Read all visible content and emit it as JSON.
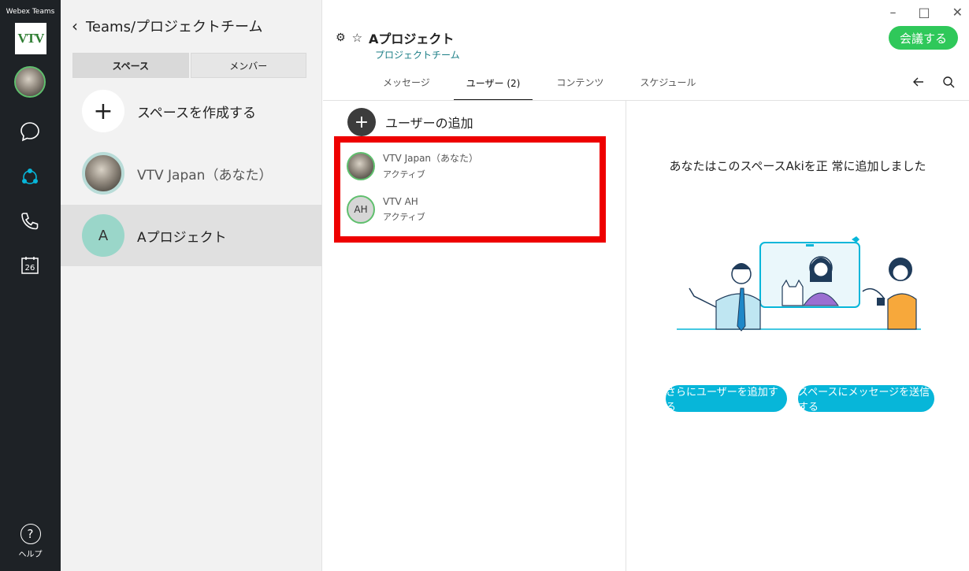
{
  "rail": {
    "app_title": "Webex Teams",
    "logo_text": "VTV",
    "calendar_day": "26",
    "help_label": "ヘルプ"
  },
  "spaces_pane": {
    "header_title": "Teams/プロジェクトチーム",
    "segments": {
      "spaces": "スペース",
      "members": "メンバー"
    },
    "create_space_label": "スペースを作成する",
    "items": [
      {
        "label": "VTV Japan（あなた）"
      },
      {
        "label": "Aプロジェクト",
        "avatar_letter": "A"
      }
    ]
  },
  "main": {
    "space_title": "Aプロジェクト",
    "space_subtitle": "プロジェクトチーム",
    "meet_button": "会議する",
    "tabs": [
      {
        "label": "メッセージ"
      },
      {
        "label": "ユーザー (2)"
      },
      {
        "label": "コンテンツ"
      },
      {
        "label": "スケジュール"
      }
    ],
    "add_user_label": "ユーザーの追加",
    "users": [
      {
        "name": "VTV Japan（あなた）",
        "status": "アクティブ"
      },
      {
        "name": "VTV AH",
        "status": "アクティブ",
        "initials": "AH"
      }
    ],
    "added_message": "あなたはこのスペースAkiを正 常に追加しました",
    "buttons": {
      "add_more_users": "さらにユーザーを追加する",
      "send_message": "スペースにメッセージを送信する"
    }
  },
  "colors": {
    "rail_bg": "#1e2226",
    "accent_green": "#2fc85a",
    "accent_cyan": "#07b6d9",
    "highlight_red": "#ee0000",
    "teal_link": "#1b7e86"
  }
}
